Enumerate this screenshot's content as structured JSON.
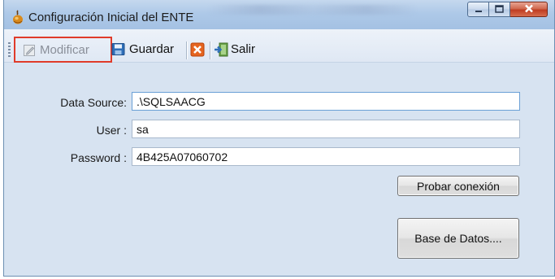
{
  "window": {
    "title": "Configuración Inicial del ENTE"
  },
  "toolbar": {
    "modificar_label": "Modificar",
    "guardar_label": "Guardar",
    "salir_label": "Salir",
    "icons": {
      "modificar": "edit-icon",
      "guardar": "save-icon",
      "cancelar": "cancel-icon",
      "salir": "exit-icon"
    }
  },
  "form": {
    "data_source_label": "Data Source:",
    "data_source_value": ".\\SQLSAACG",
    "user_label": "User :",
    "user_value": "sa",
    "password_label": "Password :",
    "password_value": "4B425A07060702"
  },
  "buttons": {
    "probar_conexion": "Probar conexión",
    "base_de_datos": "Base de Datos...."
  },
  "colors": {
    "highlight_border": "#e03b2a",
    "close_button": "#c8492d"
  }
}
